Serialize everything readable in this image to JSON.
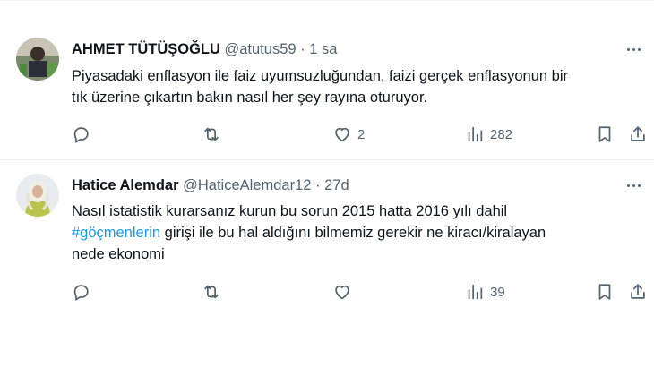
{
  "tweets": [
    {
      "author_name": "AHMET TÜTÜŞOĞLU",
      "meta": "@atutus59 · 1 sa",
      "text_lines": [
        "Piyasadaki enflasyon ile faiz uyumsuzluğundan, faizi gerçek enflasyonun bir",
        "tık üzerine çıkartın bakın nasıl her şey rayına oturuyor."
      ],
      "likes": "2",
      "views": "282"
    },
    {
      "author_name": "Hatice Alemdar",
      "meta": "@HaticeAlemdar12 · 27d",
      "text_line1": "Nasıl istatistik kurarsanız kurun bu sorun 2015 hatta 2016 yılı dahil",
      "hashtag": "#göçmenlerin",
      "text_line2_rest": " girişi ile bu hal aldığını bilmemiz gerekir ne kiracı/kiralayan",
      "text_line3": "nede ekonomi",
      "views": "39"
    }
  ],
  "icons": {
    "reply": "reply-icon",
    "retweet": "retweet-icon",
    "like": "heart-icon",
    "views": "views-icon",
    "bookmark": "bookmark-icon",
    "share": "share-icon",
    "more": "more-icon"
  },
  "colors": {
    "text": "#0f1419",
    "secondary": "#536471",
    "link": "#1d9bf0",
    "divider": "#eff3f4"
  }
}
